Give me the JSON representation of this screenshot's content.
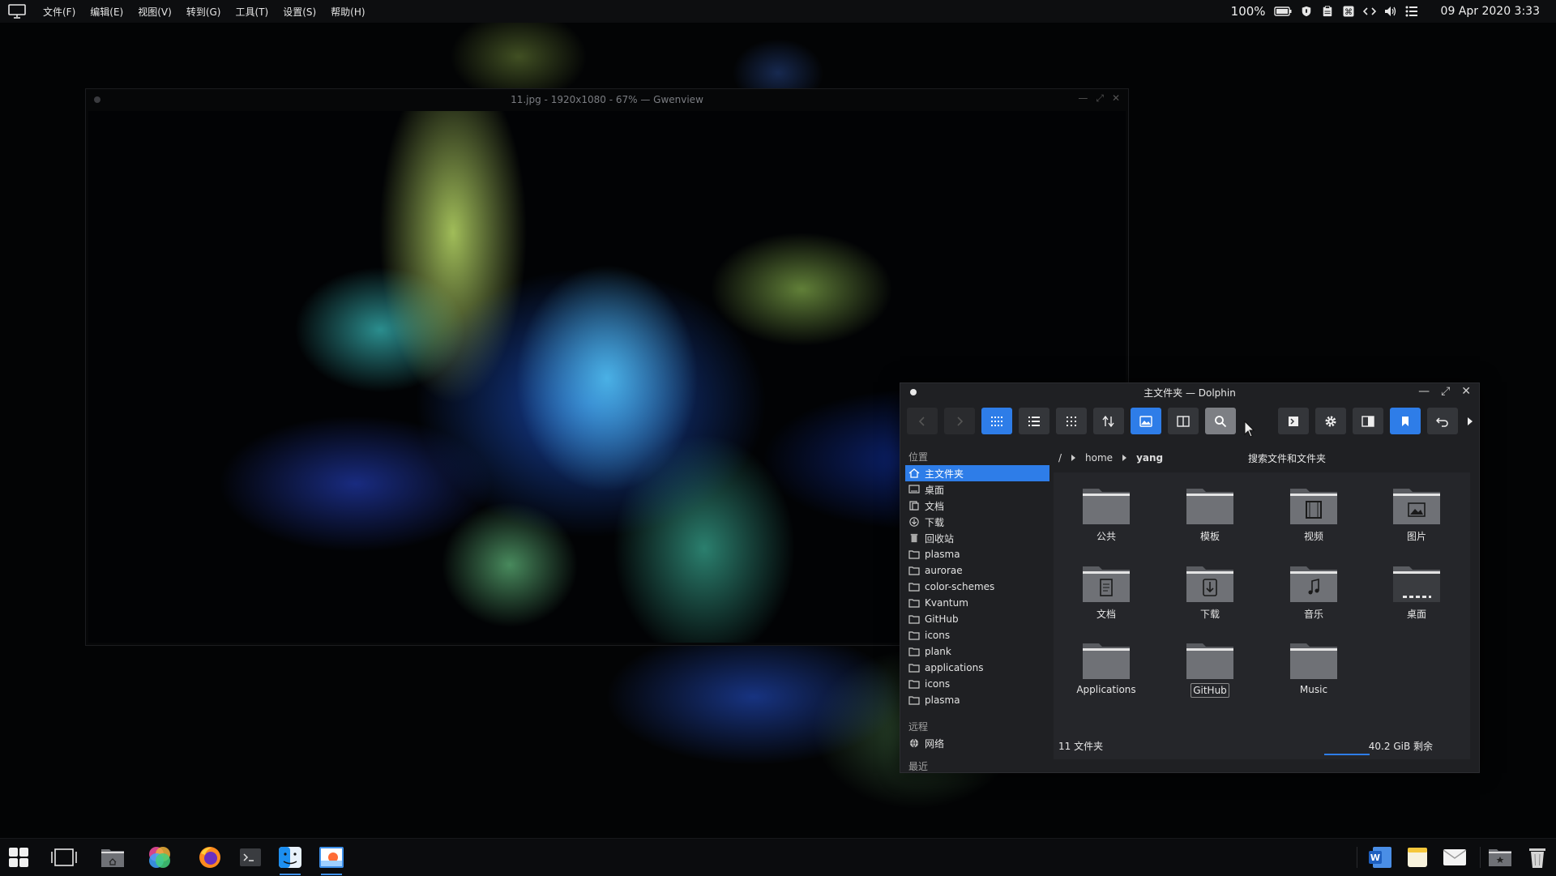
{
  "menubar": {
    "items": [
      "文件(F)",
      "编辑(E)",
      "视图(V)",
      "转到(G)",
      "工具(T)",
      "设置(S)",
      "帮助(H)"
    ],
    "battery": "100%",
    "clock": "09 Apr 2020 3:33"
  },
  "gwenview": {
    "title": "11.jpg - 1920x1080 - 67% — Gwenview"
  },
  "dolphin": {
    "title": "主文件夹 — Dolphin",
    "breadcrumb": {
      "root": "/",
      "parts": [
        "home",
        "yang"
      ]
    },
    "search_tooltip": "搜索文件和文件夹",
    "sidebar": {
      "places_header": "位置",
      "places": [
        {
          "label": "主文件夹",
          "icon": "home-icon",
          "selected": true
        },
        {
          "label": "桌面",
          "icon": "desktop-icon"
        },
        {
          "label": "文档",
          "icon": "document-icon"
        },
        {
          "label": "下载",
          "icon": "download-icon"
        },
        {
          "label": "回收站",
          "icon": "trash-icon"
        },
        {
          "label": "plasma",
          "icon": "folder-icon"
        },
        {
          "label": "aurorae",
          "icon": "folder-icon"
        },
        {
          "label": "color-schemes",
          "icon": "folder-icon"
        },
        {
          "label": "Kvantum",
          "icon": "folder-icon"
        },
        {
          "label": "GitHub",
          "icon": "folder-icon"
        },
        {
          "label": "icons",
          "icon": "folder-icon"
        },
        {
          "label": "plank",
          "icon": "folder-icon"
        },
        {
          "label": "applications",
          "icon": "folder-icon"
        },
        {
          "label": "icons",
          "icon": "folder-icon"
        },
        {
          "label": "plasma",
          "icon": "folder-icon"
        }
      ],
      "remote_header": "远程",
      "remote": [
        {
          "label": "网络",
          "icon": "network-icon"
        }
      ],
      "recent_header": "最近"
    },
    "files": [
      {
        "label": "公共",
        "emblem": "none"
      },
      {
        "label": "模板",
        "emblem": "none"
      },
      {
        "label": "视频",
        "emblem": "film"
      },
      {
        "label": "图片",
        "emblem": "picture"
      },
      {
        "label": "文档",
        "emblem": "document"
      },
      {
        "label": "下载",
        "emblem": "download"
      },
      {
        "label": "音乐",
        "emblem": "music"
      },
      {
        "label": "桌面",
        "emblem": "desktop"
      },
      {
        "label": "Applications",
        "emblem": "none"
      },
      {
        "label": "GitHub",
        "emblem": "none"
      },
      {
        "label": "Music",
        "emblem": "none"
      }
    ],
    "status": "11 文件夹",
    "free_space": "40.2 GiB 剩余",
    "free_space_used_fraction": 0.4,
    "accent": "#2e7de8"
  }
}
